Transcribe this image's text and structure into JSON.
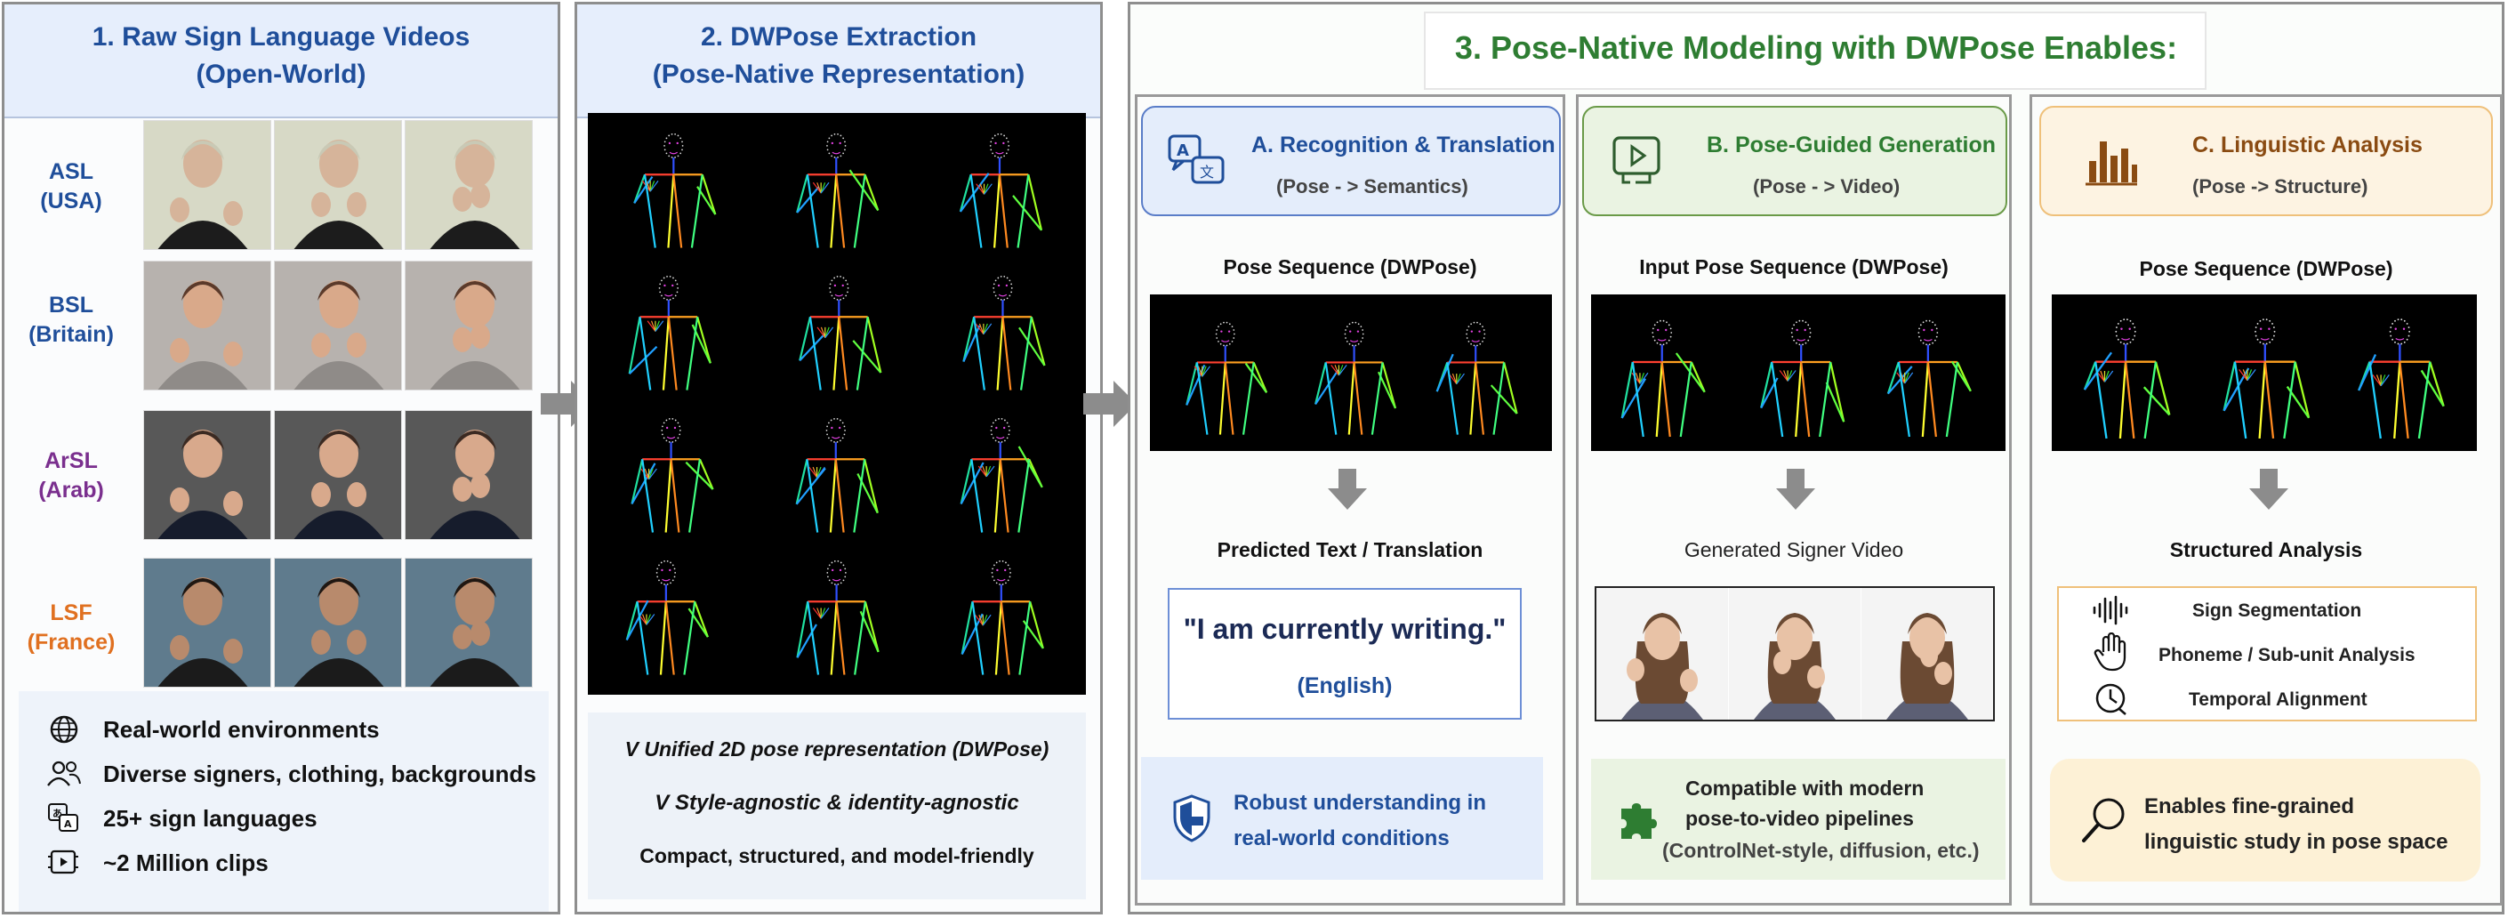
{
  "panel1": {
    "title_line1": "1. Raw Sign Language Videos",
    "title_line2": "(Open-World)",
    "languages": [
      {
        "code": "ASL",
        "region": "(USA)",
        "color": "#1f4e9a"
      },
      {
        "code": "BSL",
        "region": "(Britain)",
        "color": "#1f4e9a"
      },
      {
        "code": "ArSL",
        "region": "(Arab)",
        "color": "#7a2f8e"
      },
      {
        "code": "LSF",
        "region": "(France)",
        "color": "#e07020"
      }
    ],
    "features": [
      {
        "icon": "globe-icon",
        "text": "Real-world environments"
      },
      {
        "icon": "people-icon",
        "text": "Diverse signers, clothing, backgrounds"
      },
      {
        "icon": "translate-icon",
        "text": "25+ sign languages"
      },
      {
        "icon": "video-icon",
        "text": "~2 Million clips"
      }
    ]
  },
  "panel2": {
    "title_line1": "2. DWPose Extraction",
    "title_line2": "(Pose-Native Representation)",
    "bullets": [
      "V Unified 2D pose representation (DWPose)",
      "V Style-agnostic & identity-agnostic",
      "Compact, structured, and model-friendly"
    ]
  },
  "panel3": {
    "title": "3. Pose-Native Modeling with DWPose Enables:",
    "A": {
      "title": "A. Recognition & Translation",
      "subtitle": "(Pose - > Semantics)",
      "input_caption": "Pose Sequence (DWPose)",
      "output_caption": "Predicted Text / Translation",
      "quote": "\"I am currently writing.\"",
      "lang": "(English)",
      "footer_line1": "Robust understanding in",
      "footer_line2": "real-world conditions"
    },
    "B": {
      "title": "B. Pose-Guided Generation",
      "subtitle": "(Pose - > Video)",
      "input_caption": "Input Pose Sequence (DWPose)",
      "output_caption": "Generated Signer Video",
      "footer_line1": "Compatible with modern",
      "footer_line2": "pose-to-video pipelines",
      "footer_line3": "(ControlNet-style, diffusion, etc.)"
    },
    "C": {
      "title": "C. Linguistic Analysis",
      "subtitle": "(Pose -> Structure)",
      "input_caption": "Pose Sequence (DWPose)",
      "output_caption": "Structured Analysis",
      "items": [
        {
          "icon": "waveform-icon",
          "text": "Sign Segmentation"
        },
        {
          "icon": "hand-icon",
          "text": "Phoneme / Sub-unit Analysis"
        },
        {
          "icon": "clock-icon",
          "text": "Temporal Alignment"
        }
      ],
      "footer_line1": "Enables fine-grained",
      "footer_line2": "linguistic study in pose space"
    }
  },
  "colors": {
    "blue": "#1f4e9a",
    "green": "#2e7d32",
    "orange": "#8a4b12",
    "arrow": "#8c8c8c"
  }
}
